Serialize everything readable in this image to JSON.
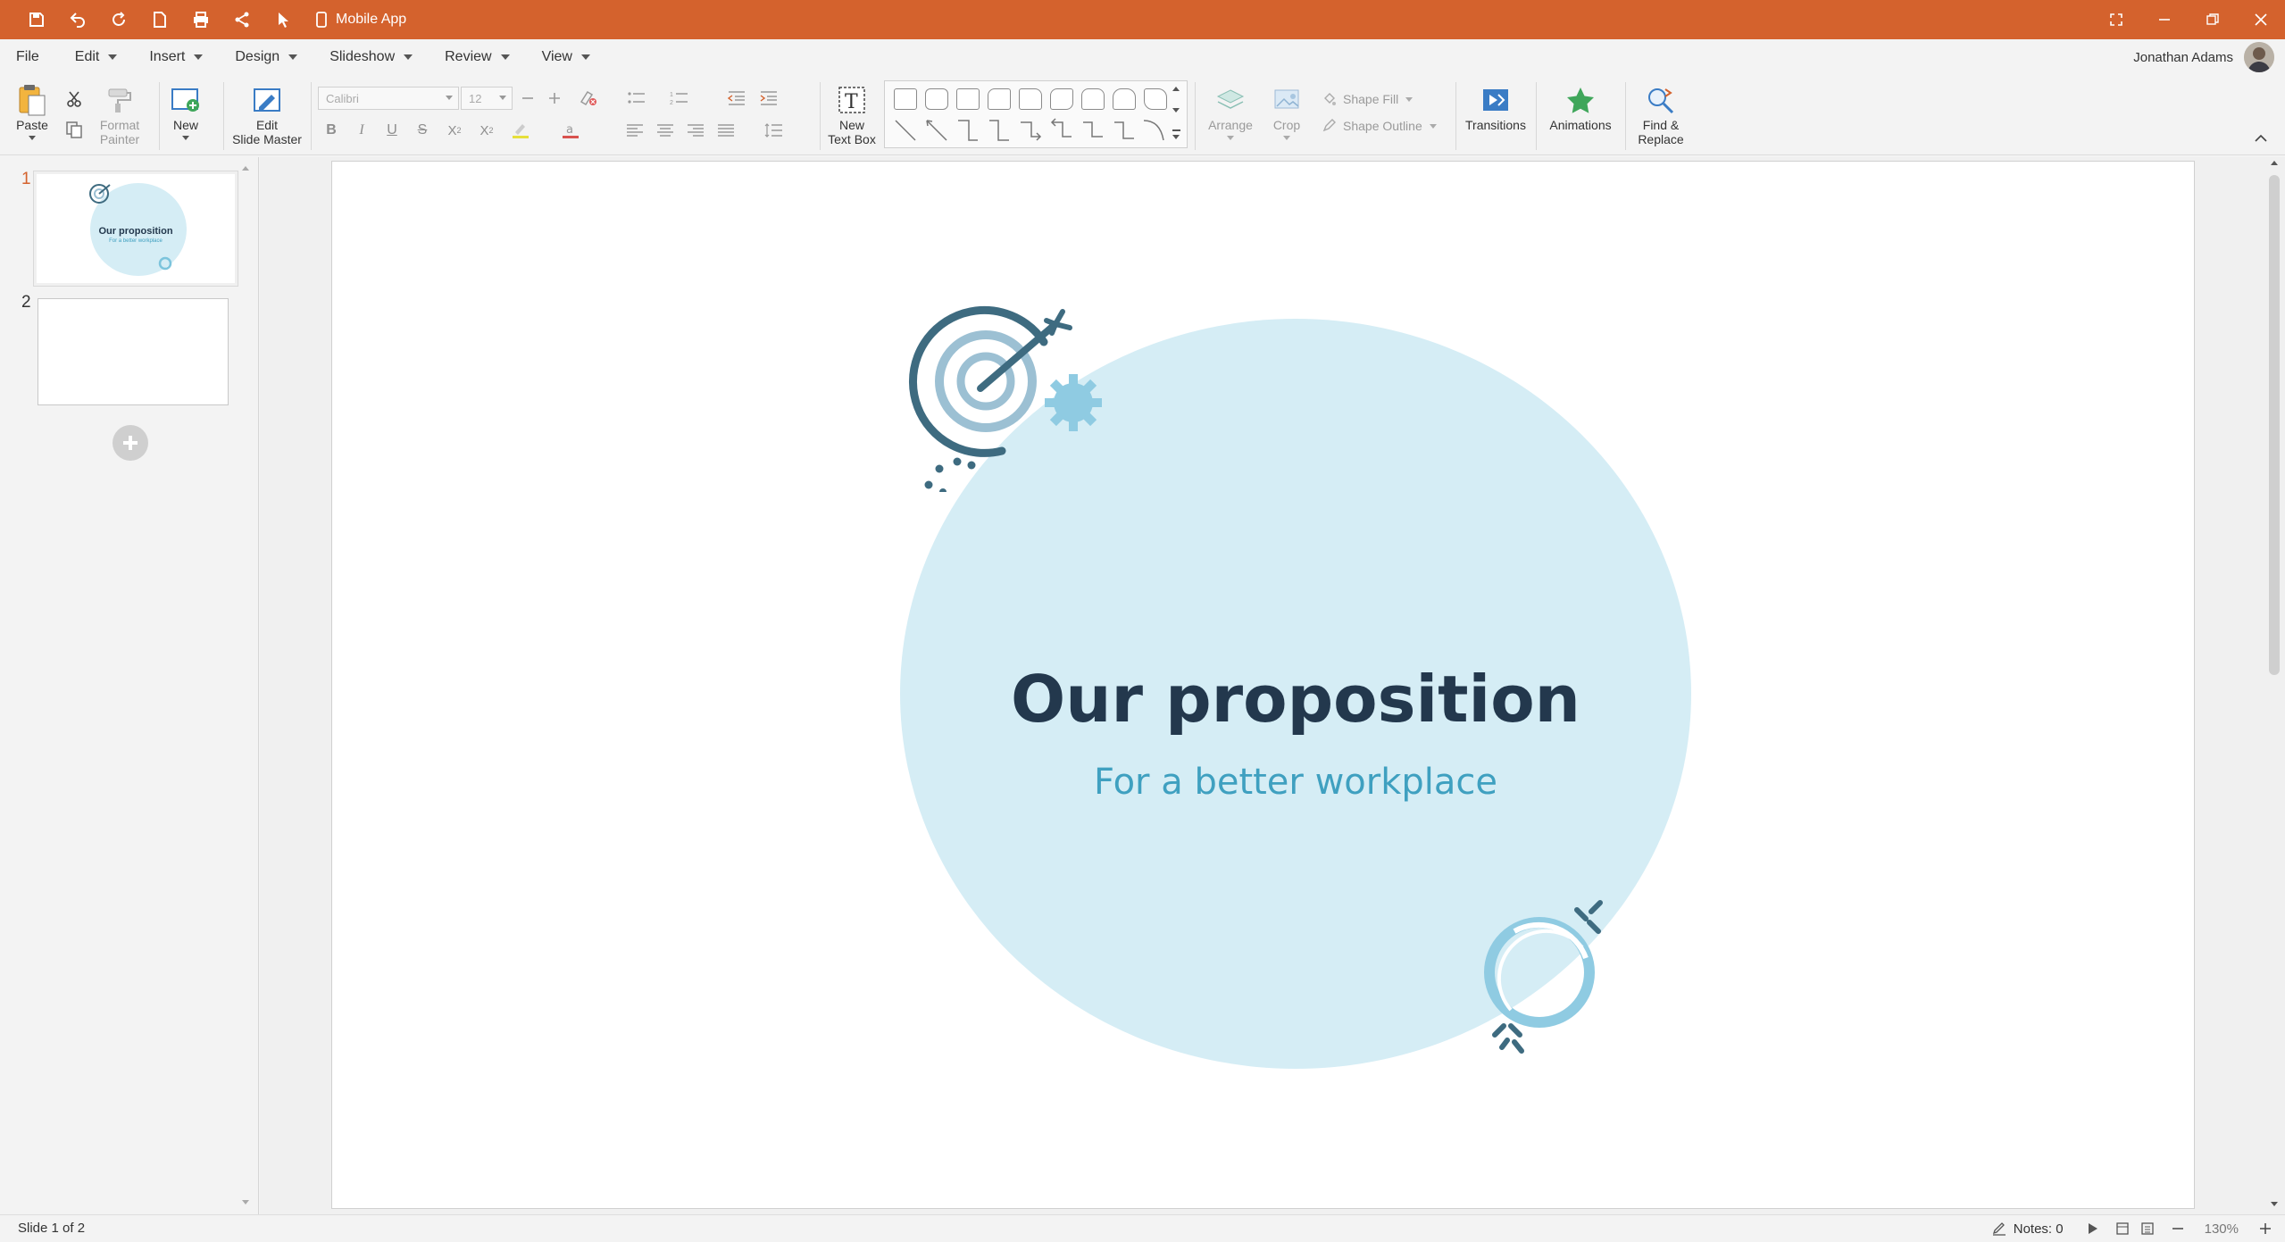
{
  "titlebar": {
    "doc_title": "Mobile App",
    "accent_color": "#d4622d",
    "quick_access": [
      "save-icon",
      "undo-icon",
      "redo-icon",
      "new-document-icon",
      "print-icon",
      "share-icon",
      "pointer-icon"
    ]
  },
  "menu": {
    "items": [
      "File",
      "Edit",
      "Insert",
      "Design",
      "Slideshow",
      "Review",
      "View"
    ],
    "user_name": "Jonathan Adams"
  },
  "ribbon": {
    "paste": "Paste",
    "format_painter_1": "Format",
    "format_painter_2": "Painter",
    "new": "New",
    "edit_master_1": "Edit",
    "edit_master_2": "Slide Master",
    "font_name": "Calibri",
    "font_size": "12",
    "new_textbox_1": "New",
    "new_textbox_2": "Text Box",
    "arrange": "Arrange",
    "crop": "Crop",
    "shape_fill": "Shape Fill",
    "shape_outline": "Shape Outline",
    "transitions": "Transitions",
    "animations": "Animations",
    "find_replace_1": "Find &",
    "find_replace_2": "Replace"
  },
  "slides_panel": {
    "slides": [
      {
        "number": "1",
        "title": "Our proposition",
        "subtitle": "For a better workplace"
      },
      {
        "number": "2"
      }
    ]
  },
  "slide": {
    "title": "Our proposition",
    "subtitle": "For a better workplace",
    "circle_color": "#d5edf5",
    "title_color": "#23384d",
    "subtitle_color": "#3fa0c0"
  },
  "status": {
    "slide_info": "Slide 1 of 2",
    "notes": "Notes: 0",
    "zoom": "130%"
  }
}
